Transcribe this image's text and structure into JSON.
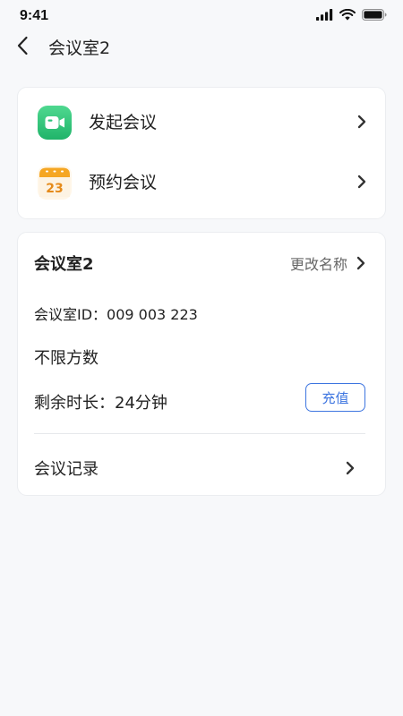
{
  "status_bar": {
    "time": "9:41",
    "icons": [
      "signal-icon",
      "wifi-icon",
      "battery-icon"
    ]
  },
  "nav": {
    "title": "会议室2",
    "back_icon": "chevron-left-icon"
  },
  "actions": [
    {
      "label": "发起会议",
      "icon": "video-camera-icon",
      "icon_color": "#2bc37a"
    },
    {
      "label": "预约会议",
      "icon": "calendar-icon",
      "icon_color": "#f5a623",
      "calendar_day": "23"
    }
  ],
  "room": {
    "title": "会议室2",
    "rename_label": "更改名称",
    "id_text": "会议室ID：009 003 223",
    "limit_text": "不限方数",
    "remaining_text": "剩余时长：24分钟",
    "recharge_label": "充值",
    "records_label": "会议记录"
  },
  "colors": {
    "accent_blue": "#3d75e0",
    "background": "#f7f8fa",
    "card": "#ffffff"
  }
}
